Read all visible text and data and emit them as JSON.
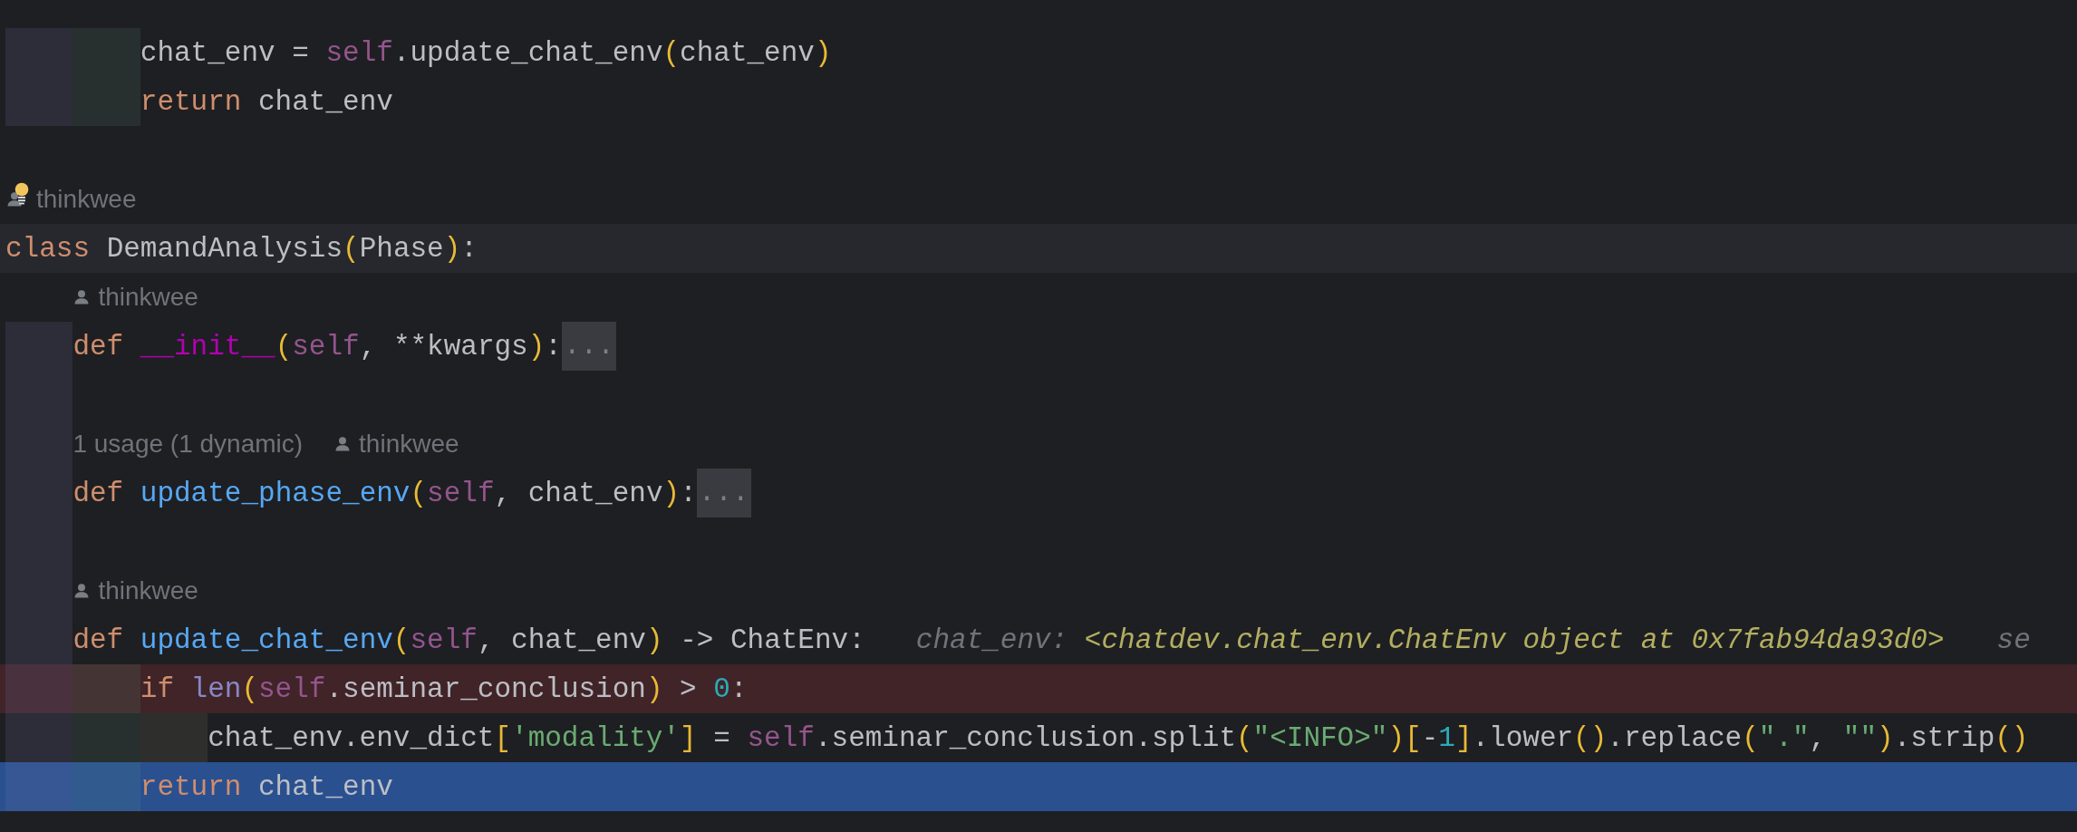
{
  "editor": {
    "lines": [
      {
        "kind": "code",
        "caret_line": false,
        "breakpoint": false,
        "execution_point": false,
        "tokens": [
          {
            "text": "        chat_env = ",
            "kind": "plain"
          },
          {
            "text": "self",
            "kind": "self"
          },
          {
            "text": ".update_chat_env",
            "kind": "plain"
          },
          {
            "text": "(",
            "kind": "paren"
          },
          {
            "text": "chat_env",
            "kind": "plain"
          },
          {
            "text": ")",
            "kind": "paren"
          }
        ]
      },
      {
        "kind": "code",
        "caret_line": false,
        "breakpoint": false,
        "execution_point": false,
        "tokens": [
          {
            "text": "        return",
            "kind": "keyword"
          },
          {
            "text": " chat_env",
            "kind": "plain"
          }
        ]
      },
      {
        "kind": "blank"
      },
      {
        "kind": "hint",
        "bulb": true,
        "items": [
          {
            "kind": "author",
            "text": "thinkwee"
          }
        ]
      },
      {
        "kind": "code",
        "caret_line": true,
        "breakpoint": false,
        "execution_point": false,
        "tokens": [
          {
            "text": "class ",
            "kind": "keyword"
          },
          {
            "text": "DemandAnalysis",
            "kind": "plain"
          },
          {
            "text": "(",
            "kind": "paren"
          },
          {
            "text": "Phase",
            "kind": "plain"
          },
          {
            "text": ")",
            "kind": "paren"
          },
          {
            "text": ":",
            "kind": "plain"
          }
        ]
      },
      {
        "kind": "hint",
        "bulb": false,
        "items": [
          {
            "kind": "author",
            "text": "thinkwee"
          }
        ]
      },
      {
        "kind": "code",
        "caret_line": false,
        "breakpoint": false,
        "execution_point": false,
        "fold": "...",
        "tokens": [
          {
            "text": "    def ",
            "kind": "keyword"
          },
          {
            "text": "__init__",
            "kind": "magic"
          },
          {
            "text": "(",
            "kind": "paren"
          },
          {
            "text": "self",
            "kind": "self"
          },
          {
            "text": ", **kwargs",
            "kind": "plain"
          },
          {
            "text": ")",
            "kind": "paren"
          },
          {
            "text": ":",
            "kind": "plain"
          }
        ]
      },
      {
        "kind": "blank"
      },
      {
        "kind": "hint",
        "bulb": false,
        "items": [
          {
            "kind": "usage",
            "text": "1 usage (1 dynamic)"
          },
          {
            "kind": "author",
            "text": "thinkwee"
          }
        ]
      },
      {
        "kind": "code",
        "caret_line": false,
        "breakpoint": false,
        "execution_point": false,
        "fold": "...",
        "tokens": [
          {
            "text": "    def ",
            "kind": "keyword"
          },
          {
            "text": "update_phase_env",
            "kind": "function"
          },
          {
            "text": "(",
            "kind": "paren"
          },
          {
            "text": "self",
            "kind": "self"
          },
          {
            "text": ", chat_env",
            "kind": "plain"
          },
          {
            "text": ")",
            "kind": "paren"
          },
          {
            "text": ":",
            "kind": "plain"
          }
        ]
      },
      {
        "kind": "blank"
      },
      {
        "kind": "hint",
        "bulb": false,
        "items": [
          {
            "kind": "author",
            "text": "thinkwee"
          }
        ]
      },
      {
        "kind": "code",
        "caret_line": false,
        "breakpoint": false,
        "execution_point": false,
        "tokens": [
          {
            "text": "    def ",
            "kind": "keyword"
          },
          {
            "text": "update_chat_env",
            "kind": "function"
          },
          {
            "text": "(",
            "kind": "paren"
          },
          {
            "text": "self",
            "kind": "self"
          },
          {
            "text": ", chat_env",
            "kind": "plain"
          },
          {
            "text": ")",
            "kind": "paren"
          },
          {
            "text": " -> ChatEnv:",
            "kind": "plain"
          }
        ],
        "inlays": [
          {
            "name": "chat_env:",
            "value": "<chatdev.chat_env.ChatEnv object at 0x7fab94da93d0>"
          },
          {
            "name": "se"
          }
        ]
      },
      {
        "kind": "code",
        "caret_line": false,
        "breakpoint": true,
        "execution_point": false,
        "tokens": [
          {
            "text": "        if ",
            "kind": "keyword"
          },
          {
            "text": "len",
            "kind": "builtin"
          },
          {
            "text": "(",
            "kind": "paren"
          },
          {
            "text": "self",
            "kind": "self"
          },
          {
            "text": ".seminar_conclusion",
            "kind": "plain"
          },
          {
            "text": ")",
            "kind": "paren"
          },
          {
            "text": " > ",
            "kind": "plain"
          },
          {
            "text": "0",
            "kind": "number"
          },
          {
            "text": ":",
            "kind": "plain"
          }
        ]
      },
      {
        "kind": "code",
        "caret_line": false,
        "breakpoint": false,
        "execution_point": false,
        "tokens": [
          {
            "text": "            chat_env.env_dict",
            "kind": "plain"
          },
          {
            "text": "[",
            "kind": "paren"
          },
          {
            "text": "'modality'",
            "kind": "string"
          },
          {
            "text": "]",
            "kind": "paren"
          },
          {
            "text": " = ",
            "kind": "plain"
          },
          {
            "text": "self",
            "kind": "self"
          },
          {
            "text": ".seminar_conclusion.split",
            "kind": "plain"
          },
          {
            "text": "(",
            "kind": "paren"
          },
          {
            "text": "\"<INFO>\"",
            "kind": "string"
          },
          {
            "text": ")",
            "kind": "paren"
          },
          {
            "text": "[",
            "kind": "paren"
          },
          {
            "text": "-",
            "kind": "plain"
          },
          {
            "text": "1",
            "kind": "number"
          },
          {
            "text": "]",
            "kind": "paren"
          },
          {
            "text": ".lower",
            "kind": "plain"
          },
          {
            "text": "()",
            "kind": "paren"
          },
          {
            "text": ".replace",
            "kind": "plain"
          },
          {
            "text": "(",
            "kind": "paren"
          },
          {
            "text": "\".\"",
            "kind": "string"
          },
          {
            "text": ", ",
            "kind": "plain"
          },
          {
            "text": "\"\"",
            "kind": "string"
          },
          {
            "text": ")",
            "kind": "paren"
          },
          {
            "text": ".strip",
            "kind": "plain"
          },
          {
            "text": "()",
            "kind": "paren"
          }
        ]
      },
      {
        "kind": "code",
        "caret_line": false,
        "breakpoint": false,
        "execution_point": true,
        "tokens": [
          {
            "text": "        return",
            "kind": "keyword"
          },
          {
            "text": " chat_env",
            "kind": "plain"
          }
        ]
      }
    ]
  }
}
